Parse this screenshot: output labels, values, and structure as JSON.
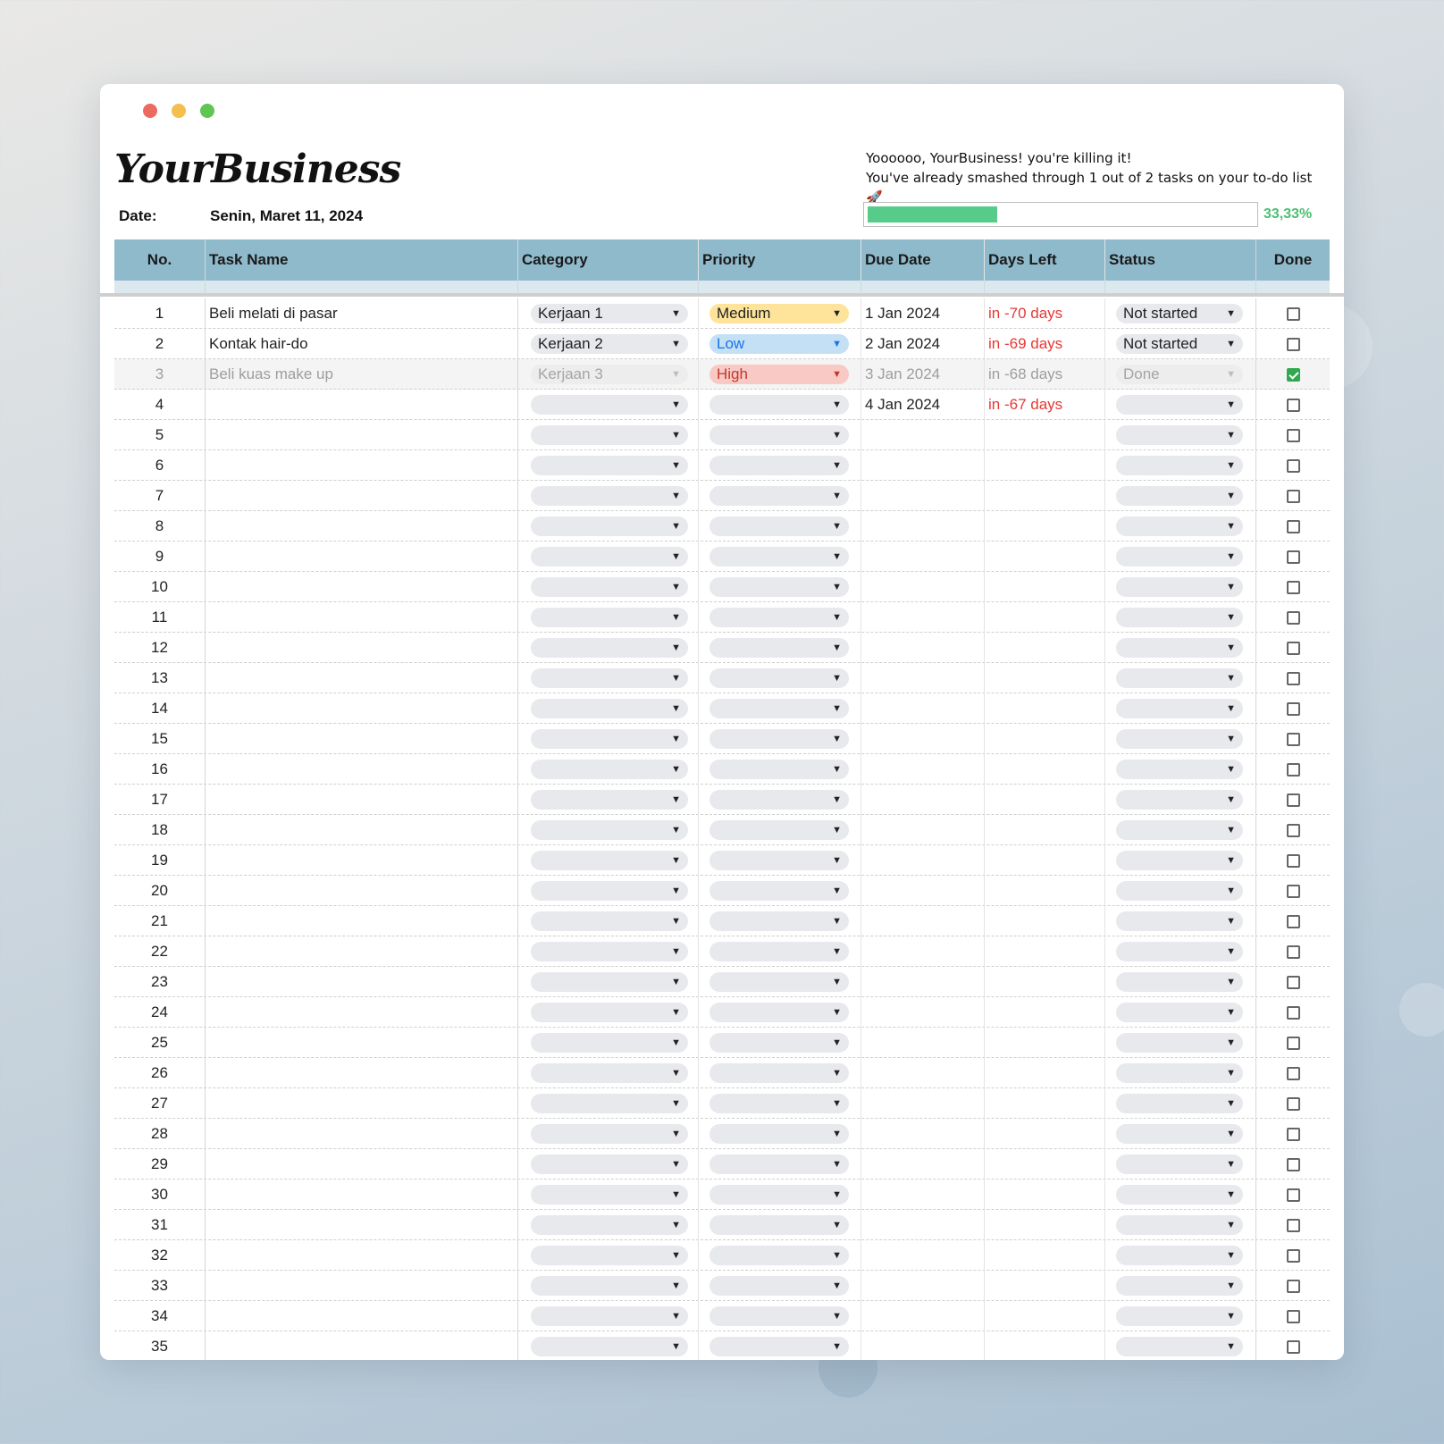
{
  "window": {
    "controls": {
      "close_color": "#ec6a5e",
      "minimize_color": "#f4bf4f",
      "maximize_color": "#61c554"
    }
  },
  "header": {
    "logo_text": "YourBusiness",
    "date_label": "Date:",
    "date_value": "Senin, Maret 11, 2024",
    "message_line1": "Yoooooo, YourBusiness! you're killing it!",
    "message_line2": "You've already smashed through 1 out of 2 tasks on your to-do list",
    "message_emoji": "🚀",
    "progress_fraction": 0.3333,
    "progress_text": "33,33%",
    "accent_green": "#57cc8a"
  },
  "table": {
    "columns": [
      "No.",
      "Task Name",
      "Category",
      "Priority",
      "Due Date",
      "Days Left",
      "Status",
      "Done"
    ],
    "header_color": "#8fbacb",
    "rows": [
      {
        "no": "1",
        "task": "Beli melati di pasar",
        "category": "Kerjaan 1",
        "priority": "Medium",
        "due": "1 Jan 2024",
        "days": "in -70 days",
        "status": "Not started",
        "done": false
      },
      {
        "no": "2",
        "task": "Kontak hair-do",
        "category": "Kerjaan 2",
        "priority": "Low",
        "due": "2 Jan 2024",
        "days": "in -69 days",
        "status": "Not started",
        "done": false
      },
      {
        "no": "3",
        "task": "Beli kuas make up",
        "category": "Kerjaan 3",
        "priority": "High",
        "due": "3 Jan 2024",
        "days": "in -68 days",
        "status": "Done",
        "done": true
      },
      {
        "no": "4",
        "task": "",
        "category": "",
        "priority": "",
        "due": "4 Jan 2024",
        "days": "in -67 days",
        "status": "",
        "done": false
      },
      {
        "no": "5",
        "task": "",
        "category": "",
        "priority": "",
        "due": "",
        "days": "",
        "status": "",
        "done": false
      },
      {
        "no": "6",
        "task": "",
        "category": "",
        "priority": "",
        "due": "",
        "days": "",
        "status": "",
        "done": false
      },
      {
        "no": "7",
        "task": "",
        "category": "",
        "priority": "",
        "due": "",
        "days": "",
        "status": "",
        "done": false
      },
      {
        "no": "8",
        "task": "",
        "category": "",
        "priority": "",
        "due": "",
        "days": "",
        "status": "",
        "done": false
      },
      {
        "no": "9",
        "task": "",
        "category": "",
        "priority": "",
        "due": "",
        "days": "",
        "status": "",
        "done": false
      },
      {
        "no": "10",
        "task": "",
        "category": "",
        "priority": "",
        "due": "",
        "days": "",
        "status": "",
        "done": false
      },
      {
        "no": "11",
        "task": "",
        "category": "",
        "priority": "",
        "due": "",
        "days": "",
        "status": "",
        "done": false
      },
      {
        "no": "12",
        "task": "",
        "category": "",
        "priority": "",
        "due": "",
        "days": "",
        "status": "",
        "done": false
      },
      {
        "no": "13",
        "task": "",
        "category": "",
        "priority": "",
        "due": "",
        "days": "",
        "status": "",
        "done": false
      },
      {
        "no": "14",
        "task": "",
        "category": "",
        "priority": "",
        "due": "",
        "days": "",
        "status": "",
        "done": false
      },
      {
        "no": "15",
        "task": "",
        "category": "",
        "priority": "",
        "due": "",
        "days": "",
        "status": "",
        "done": false
      },
      {
        "no": "16",
        "task": "",
        "category": "",
        "priority": "",
        "due": "",
        "days": "",
        "status": "",
        "done": false
      },
      {
        "no": "17",
        "task": "",
        "category": "",
        "priority": "",
        "due": "",
        "days": "",
        "status": "",
        "done": false
      },
      {
        "no": "18",
        "task": "",
        "category": "",
        "priority": "",
        "due": "",
        "days": "",
        "status": "",
        "done": false
      },
      {
        "no": "19",
        "task": "",
        "category": "",
        "priority": "",
        "due": "",
        "days": "",
        "status": "",
        "done": false
      },
      {
        "no": "20",
        "task": "",
        "category": "",
        "priority": "",
        "due": "",
        "days": "",
        "status": "",
        "done": false
      },
      {
        "no": "21",
        "task": "",
        "category": "",
        "priority": "",
        "due": "",
        "days": "",
        "status": "",
        "done": false
      },
      {
        "no": "22",
        "task": "",
        "category": "",
        "priority": "",
        "due": "",
        "days": "",
        "status": "",
        "done": false
      },
      {
        "no": "23",
        "task": "",
        "category": "",
        "priority": "",
        "due": "",
        "days": "",
        "status": "",
        "done": false
      },
      {
        "no": "24",
        "task": "",
        "category": "",
        "priority": "",
        "due": "",
        "days": "",
        "status": "",
        "done": false
      },
      {
        "no": "25",
        "task": "",
        "category": "",
        "priority": "",
        "due": "",
        "days": "",
        "status": "",
        "done": false
      },
      {
        "no": "26",
        "task": "",
        "category": "",
        "priority": "",
        "due": "",
        "days": "",
        "status": "",
        "done": false
      },
      {
        "no": "27",
        "task": "",
        "category": "",
        "priority": "",
        "due": "",
        "days": "",
        "status": "",
        "done": false
      },
      {
        "no": "28",
        "task": "",
        "category": "",
        "priority": "",
        "due": "",
        "days": "",
        "status": "",
        "done": false
      },
      {
        "no": "29",
        "task": "",
        "category": "",
        "priority": "",
        "due": "",
        "days": "",
        "status": "",
        "done": false
      },
      {
        "no": "30",
        "task": "",
        "category": "",
        "priority": "",
        "due": "",
        "days": "",
        "status": "",
        "done": false
      },
      {
        "no": "31",
        "task": "",
        "category": "",
        "priority": "",
        "due": "",
        "days": "",
        "status": "",
        "done": false
      },
      {
        "no": "32",
        "task": "",
        "category": "",
        "priority": "",
        "due": "",
        "days": "",
        "status": "",
        "done": false
      },
      {
        "no": "33",
        "task": "",
        "category": "",
        "priority": "",
        "due": "",
        "days": "",
        "status": "",
        "done": false
      },
      {
        "no": "34",
        "task": "",
        "category": "",
        "priority": "",
        "due": "",
        "days": "",
        "status": "",
        "done": false
      },
      {
        "no": "35",
        "task": "",
        "category": "",
        "priority": "",
        "due": "",
        "days": "",
        "status": "",
        "done": false
      }
    ]
  }
}
